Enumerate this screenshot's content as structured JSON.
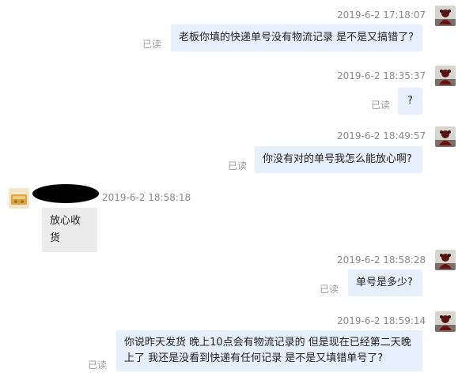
{
  "messages": [
    {
      "side": "sent",
      "timestamp": "2019-6-2 17:18:07",
      "text": "老板你填的快递单号没有物流记录 是不是又搞错了?",
      "read": "已读"
    },
    {
      "side": "sent",
      "timestamp": "2019-6-2 18:35:37",
      "text": "?",
      "read": "已读"
    },
    {
      "side": "sent",
      "timestamp": "2019-6-2 18:49:57",
      "text": "你没有对的单号我怎么能放心啊?",
      "read": "已读"
    },
    {
      "side": "received",
      "timestamp": "2019-6-2 18:58:18",
      "text": "放心收货"
    },
    {
      "side": "sent",
      "timestamp": "2019-6-2 18:58:28",
      "text": "单号是多少?",
      "read": "已读"
    },
    {
      "side": "sent",
      "timestamp": "2019-6-2 18:59:14",
      "text": "你说昨天发货 晚上10点会有物流记录的 但是现在已经第二天晚上了 我还是没看到快递有任何记录 是不是又填错单号了?",
      "read": "已读"
    }
  ],
  "colors": {
    "sent_bubble": "#e5f0fc",
    "received_bubble": "#ececec",
    "timestamp": "#888888",
    "read_receipt": "#999999"
  },
  "icons": {
    "my_avatar": "dark-red-figure-avatar",
    "contact_avatar": "golden-food-avatar",
    "contact_name": "redacted-name-blot"
  }
}
